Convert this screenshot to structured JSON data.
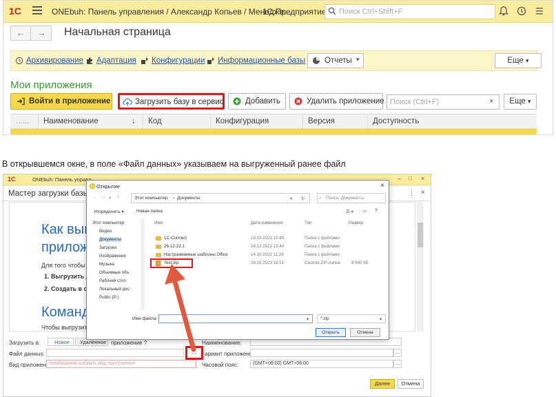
{
  "app": {
    "logo": "1С",
    "title": "ONEbuh: Панель управления / Александр Копьев / Менедже...",
    "platform": "1С:Предприятие",
    "search_placeholder": "Поиск Ctrl+Shift+F"
  },
  "page": {
    "title": "Начальная страница"
  },
  "command_bar": {
    "links": [
      "Архивирование",
      "Адаптация",
      "Конфигурации",
      "Информационные базы"
    ],
    "reports_label": "Отчеты",
    "more_label": "Еще"
  },
  "apps": {
    "title": "Мои приложения",
    "buttons": {
      "login": "Войти в приложение",
      "upload": "Загрузить базу в сервис",
      "add": "Добавить",
      "delete": "Удалить приложение"
    },
    "search_placeholder": "Поиск (Ctrl+F)",
    "more_label": "Еще",
    "columns": [
      "......",
      "Наименование",
      "Код",
      "Конфигурация",
      "Версия",
      "Доступность"
    ]
  },
  "caption": "В открывшемся окне, в поле «Файл данных» указываем на выгруженный ранее файл",
  "wizard": {
    "topbar_title": "ONEbuh: Панель управл",
    "title": "Мастер загрузки базы в",
    "heading1a": "Как выг",
    "heading1b": "прилож",
    "intro": "Для того чтобы",
    "steps": [
      "1.  Выгрузить д",
      "2.  Создать в с"
    ],
    "heading2": "Команд",
    "text2": "Чтобы выгрузить",
    "fields": {
      "load_to_label": "Загрузить в:",
      "radio_new": "Новое",
      "radio_existing": "Удаленное",
      "radio_suffix": "приложение ?",
      "name_label": "Наименование:",
      "data_file_label": "Файл данных:",
      "variant_label": "ариант приложения:",
      "app_type_label": "Вид приложения:",
      "app_type_placeholder": "Необходимо выбрать вид приложения",
      "timezone_label": "Часовой пояс:",
      "timezone_value": "(GMT+06:00) GMT+06:00"
    },
    "next_label": "Далее",
    "cancel_label": "Отмена"
  },
  "dialog": {
    "title": "Открытие",
    "path": [
      "Этот компьютер",
      "Документы"
    ],
    "search_placeholder": "Поиск: Документы",
    "organize_label": "Упорядочить ▾",
    "new_folder_label": "Новая папка",
    "tree": [
      "Этот компьютер",
      "Видео",
      "Документы",
      "Загрузки",
      "Изображения",
      "Музыка",
      "Объемные объ",
      "Рабочий стол",
      "Локальный дис",
      "Public (P:)"
    ],
    "columns": [
      "Имя",
      "Дата изменения",
      "Тип",
      "Размер"
    ],
    "files": [
      {
        "name": "1C-Connect",
        "date": "19.10.2023 10:48",
        "type": "Папка с файлами",
        "size": ""
      },
      {
        "name": "26-12-22.1",
        "date": "26.12.2022 13:44",
        "type": "Папка с файлами",
        "size": ""
      },
      {
        "name": "Настраиваемые шаблоны Office",
        "date": "14.10.2022 11:24",
        "type": "Папка с файлами",
        "size": ""
      },
      {
        "name": "Test.zip",
        "date": "26.10.2023 18:51",
        "type": "Сжатая ZIP-папка",
        "size": "8 940 КБ"
      }
    ],
    "filename_label": "Имя файла:",
    "filetype_value": "*.zip",
    "open_label": "Открыть",
    "cancel_label": "Отмена"
  },
  "colors": {
    "accent_yellow": "#f6d94a",
    "highlight_red": "#e3151b",
    "link_blue": "#2253a6",
    "green_title": "#3a9b30"
  }
}
